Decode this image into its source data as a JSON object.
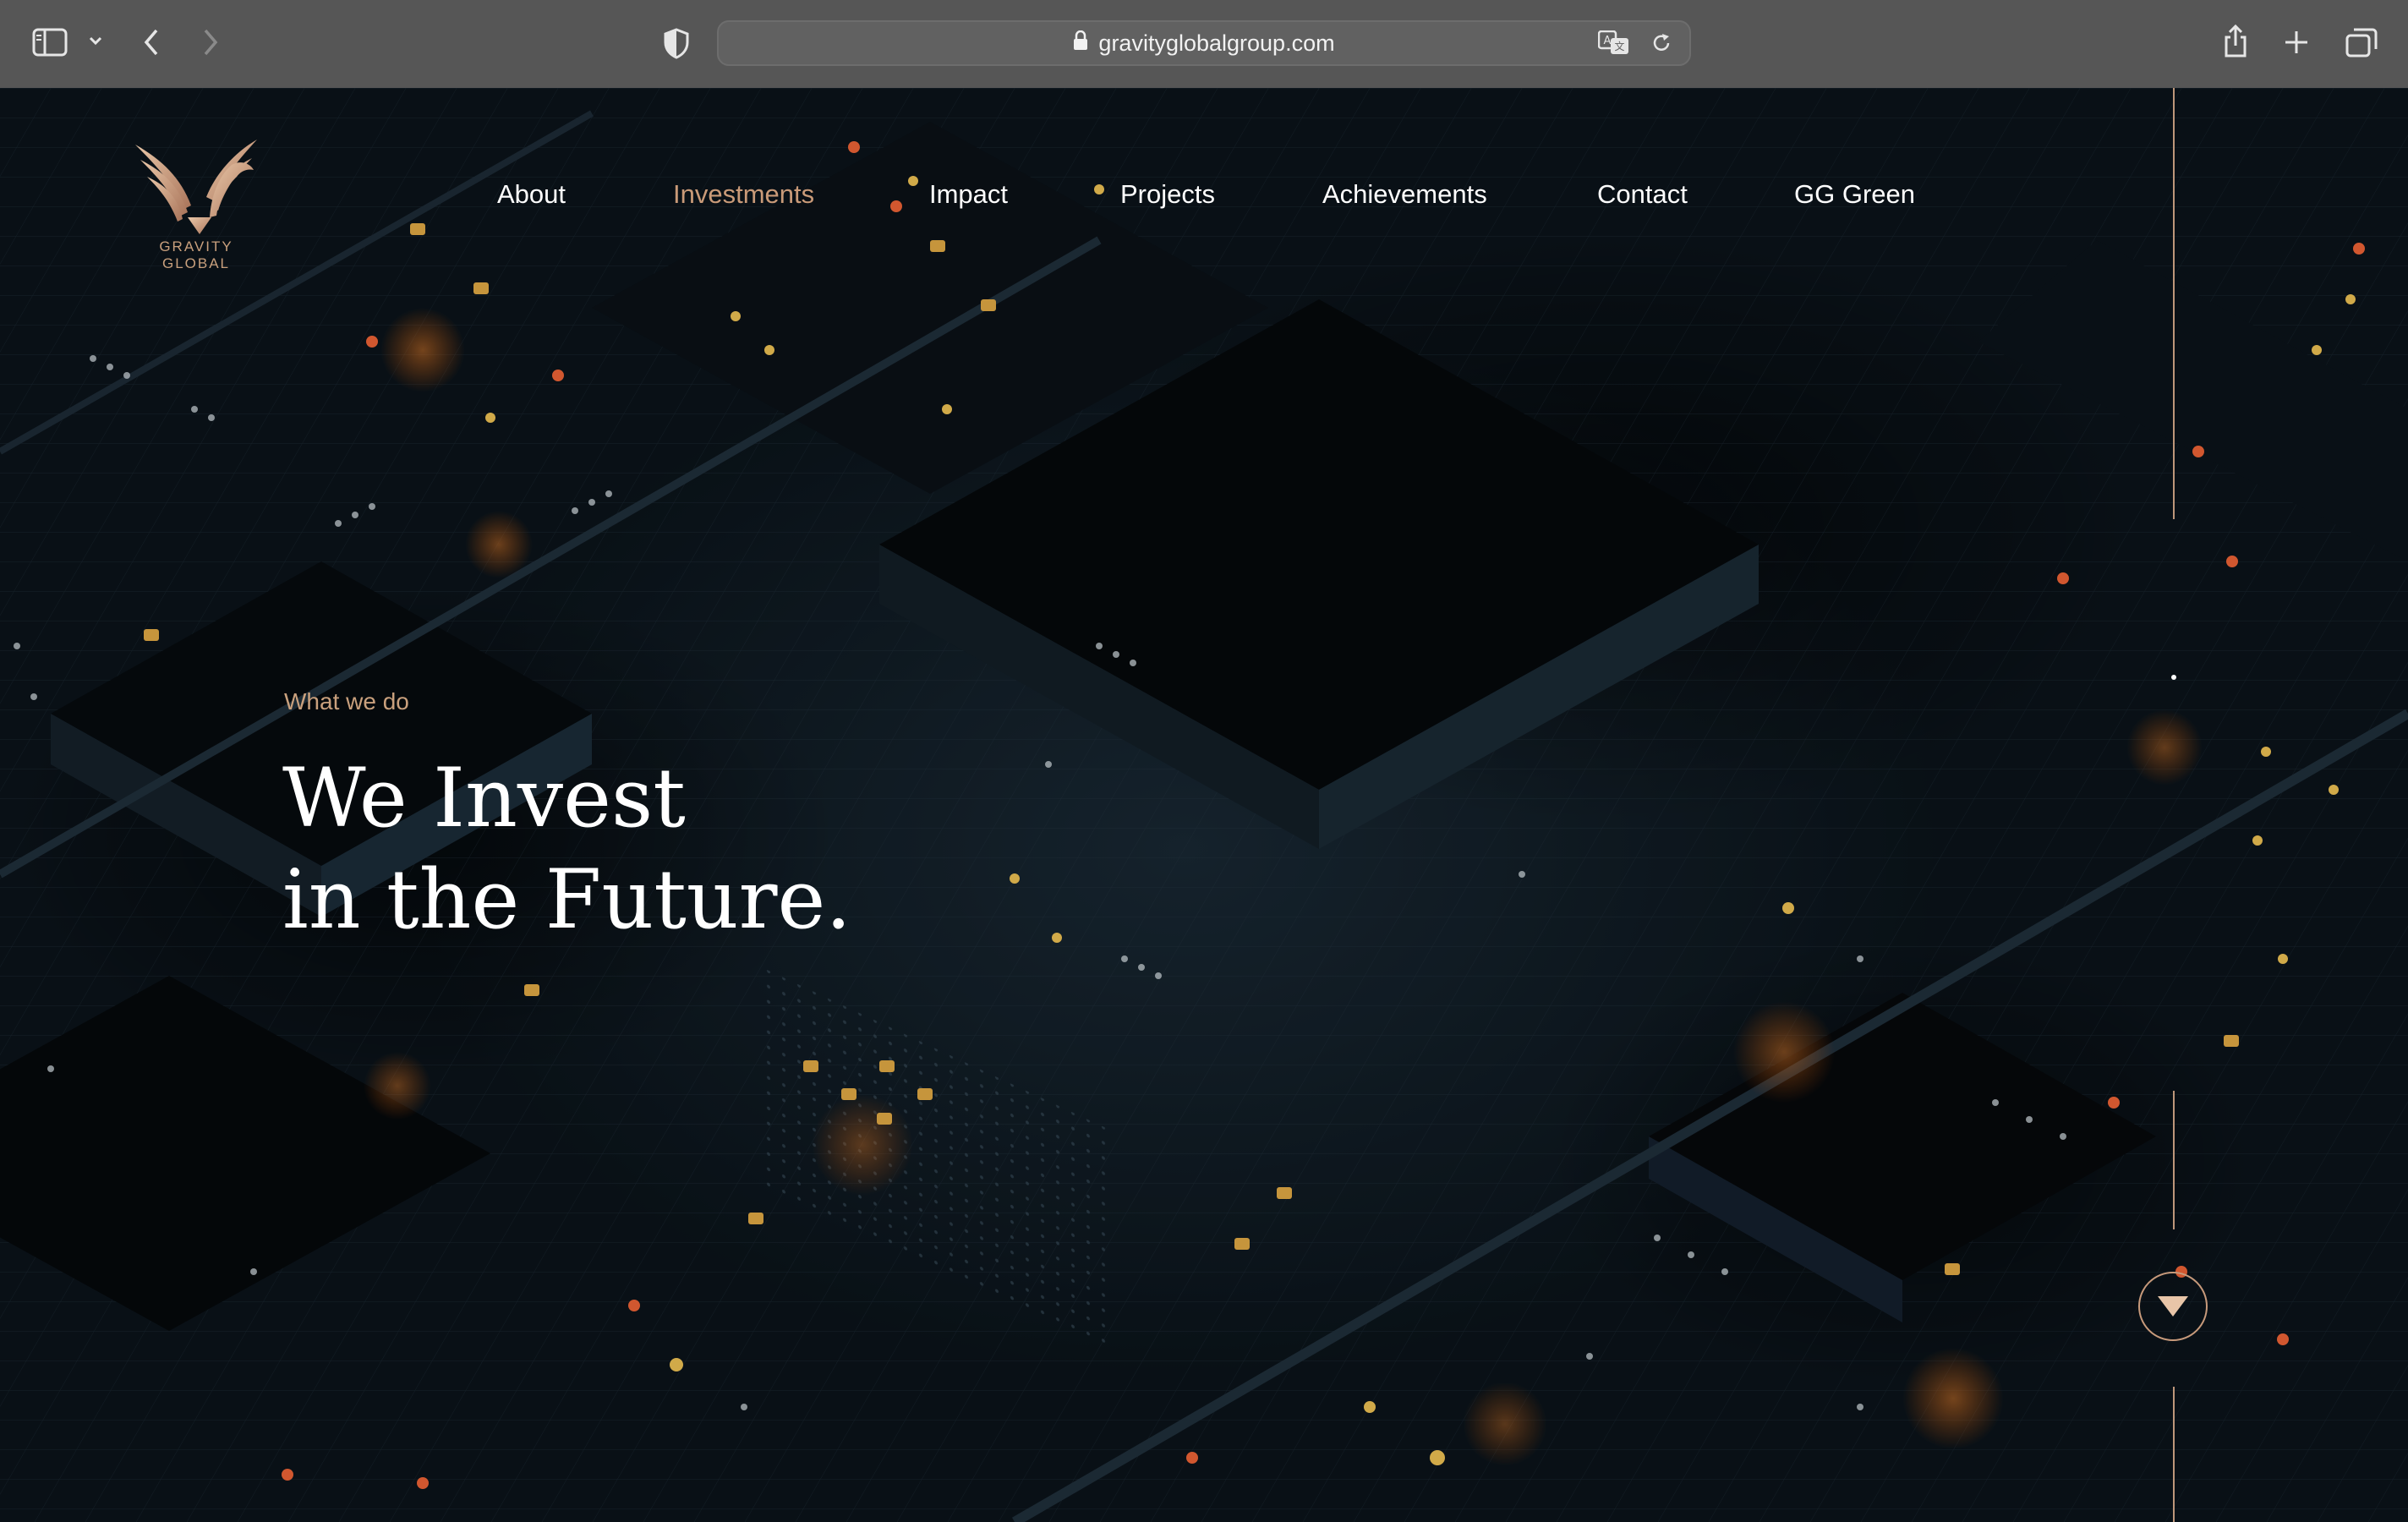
{
  "browser": {
    "url": "gravityglobalgroup.com",
    "icons": [
      "sidebar-icon",
      "chevron-down-icon",
      "back-icon",
      "forward-icon",
      "shield-icon",
      "lock-icon",
      "translate-icon",
      "reload-icon",
      "share-icon",
      "plus-icon",
      "tabs-icon"
    ]
  },
  "site": {
    "logo_text": "GRAVITY GLOBAL",
    "nav": [
      {
        "label": "About",
        "active": false
      },
      {
        "label": "Investments",
        "active": true
      },
      {
        "label": "Impact",
        "active": false
      },
      {
        "label": "Projects",
        "active": false
      },
      {
        "label": "Achievements",
        "active": false
      },
      {
        "label": "Contact",
        "active": false
      },
      {
        "label": "GG Green",
        "active": false
      }
    ],
    "hero": {
      "eyebrow": "What we do",
      "headline_line1": "We Invest",
      "headline_line2": "in the Future."
    },
    "scroll_icon": "triangle-down-icon",
    "colors": {
      "accent": "#c99a78",
      "text": "#ffffff",
      "background": "#0b1116",
      "toolbar": "#565656"
    }
  }
}
